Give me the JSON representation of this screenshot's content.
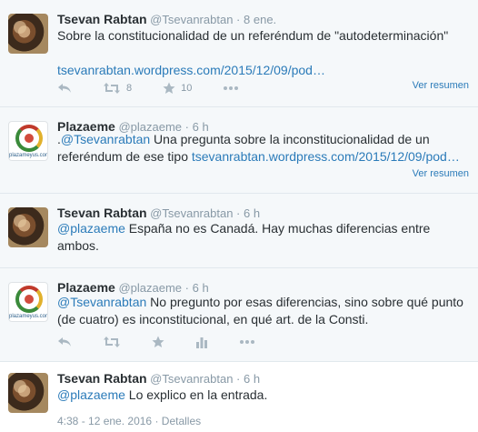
{
  "tweets": [
    {
      "name": "Tsevan Rabtan",
      "handle": "@Tsevanrabtan",
      "sep": "·",
      "time": "8 ene.",
      "text": "Sobre la constitucionalidad de un referéndum de \"autodeterminación\"",
      "link": "tsevanrabtan.wordpress.com/2015/12/09/pod…",
      "retweets": "8",
      "likes": "10",
      "summary": "Ver resumen"
    },
    {
      "name": "Plazaeme",
      "handle": "@plazaeme",
      "sep": "·",
      "time": "6 h",
      "prefix": ".",
      "mention": "@Tsevanrabtan",
      "text": " Una pregunta sobre la inconstitucionalidad de un referéndum de ese tipo ",
      "link": "tsevanrabtan.wordpress.com/2015/12/09/pod…",
      "summary": "Ver resumen",
      "avatar_text": "plazameyus.com"
    },
    {
      "name": "Tsevan Rabtan",
      "handle": "@Tsevanrabtan",
      "sep": "·",
      "time": "6 h",
      "mention": "@plazaeme",
      "text": " España no es Canadá. Hay muchas diferencias entre ambos."
    },
    {
      "name": "Plazaeme",
      "handle": "@plazaeme",
      "sep": "·",
      "time": "6 h",
      "mention": "@Tsevanrabtan",
      "text": "  No pregunto por esas diferencias, sino sobre qué punto (de cuatro) es inconstitucional, en qué art. de la Consti.",
      "avatar_text": "plazameyus.com"
    },
    {
      "name": "Tsevan Rabtan",
      "handle": "@Tsevanrabtan",
      "sep": "·",
      "time": "6 h",
      "mention": "@plazaeme",
      "text": " Lo explico en la entrada.",
      "timestamp": "4:38 - 12 ene. 2016",
      "details": "Detalles"
    }
  ],
  "colors": {
    "link": "#2b7bb9",
    "muted": "#8899a6",
    "icon": "#aab8c2",
    "background": "#f5f8fa"
  }
}
